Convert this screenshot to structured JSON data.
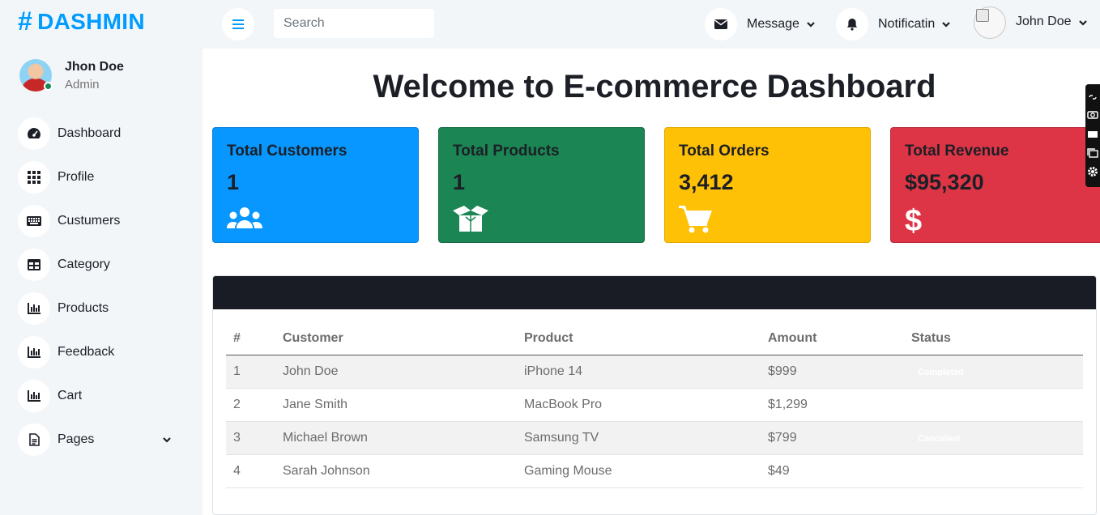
{
  "brand": {
    "name": "DASHMIN",
    "hash": "#"
  },
  "user": {
    "name": "Jhon Doe",
    "role": "Admin"
  },
  "nav": [
    {
      "label": "Dashboard",
      "icon": "tachometer-icon"
    },
    {
      "label": "Profile",
      "icon": "grid-icon"
    },
    {
      "label": "Custumers",
      "icon": "keyboard-icon"
    },
    {
      "label": "Category",
      "icon": "table-icon"
    },
    {
      "label": "Products",
      "icon": "bar-chart-icon"
    },
    {
      "label": "Feedback",
      "icon": "bar-chart-icon"
    },
    {
      "label": "Cart",
      "icon": "bar-chart-icon"
    },
    {
      "label": "Pages",
      "icon": "file-icon"
    }
  ],
  "header": {
    "search_placeholder": "Search",
    "message_label": "Message",
    "notification_label": "Notificatin",
    "profile_label": "John Doe"
  },
  "page_title": "Welcome to E-commerce Dashboard",
  "cards": [
    {
      "title": "Total Customers",
      "value": "1"
    },
    {
      "title": "Total Products",
      "value": "1"
    },
    {
      "title": "Total Orders",
      "value": "3,412"
    },
    {
      "title": "Total Revenue",
      "value": "$95,320"
    }
  ],
  "table": {
    "headers": [
      "#",
      "Customer",
      "Product",
      "Amount",
      "Status"
    ],
    "rows": [
      [
        "1",
        "John Doe",
        "iPhone 14",
        "$999",
        "Completed"
      ],
      [
        "2",
        "Jane Smith",
        "MacBook Pro",
        "$1,299",
        ""
      ],
      [
        "3",
        "Michael Brown",
        "Samsung TV",
        "$799",
        "Cancelled"
      ],
      [
        "4",
        "Sarah Johnson",
        "Gaming Mouse",
        "$49",
        ""
      ]
    ]
  },
  "colors": {
    "brand": "#009cff",
    "card_blue": "#0797ff",
    "card_green": "#1b8553",
    "card_yellow": "#ffc106",
    "card_red": "#dd3545",
    "table_header_bar": "#191c24",
    "online_status": "#198754"
  }
}
